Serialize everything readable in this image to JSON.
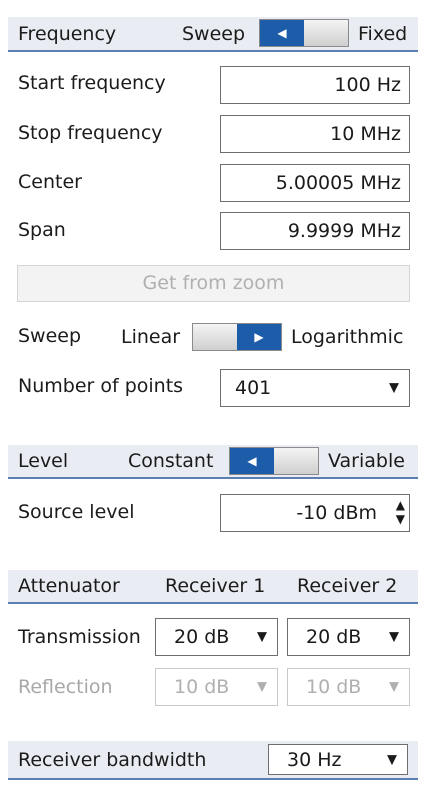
{
  "frequency": {
    "header": "Frequency",
    "sweep_label": "Sweep",
    "fixed_label": "Fixed",
    "toggle_state": "Sweep",
    "start_label": "Start frequency",
    "start_value": "100 Hz",
    "stop_label": "Stop frequency",
    "stop_value": "10 MHz",
    "center_label": "Center",
    "center_value": "5.00005 MHz",
    "span_label": "Span",
    "span_value": "9.9999 MHz",
    "get_from_zoom": "Get from zoom",
    "sweep_type_label": "Sweep",
    "linear_label": "Linear",
    "log_label": "Logarithmic",
    "sweep_type_state": "Logarithmic",
    "points_label": "Number of points",
    "points_value": "401"
  },
  "level": {
    "header": "Level",
    "constant_label": "Constant",
    "variable_label": "Variable",
    "toggle_state": "Constant",
    "source_label": "Source level",
    "source_value": "-10 dBm"
  },
  "attenuator": {
    "header": "Attenuator",
    "col1": "Receiver 1",
    "col2": "Receiver 2",
    "transmission_label": "Transmission",
    "transmission_r1": "20 dB",
    "transmission_r2": "20 dB",
    "reflection_label": "Reflection",
    "reflection_r1": "10 dB",
    "reflection_r2": "10 dB"
  },
  "bandwidth": {
    "label": "Receiver bandwidth",
    "value": "30 Hz"
  },
  "icons": {
    "left": "◀",
    "right": "▶",
    "down": "▼",
    "up": "▲"
  },
  "colors": {
    "accent": "#1c5ca8",
    "header_bg": "#e9edf3",
    "header_line": "#5a7fb0"
  }
}
